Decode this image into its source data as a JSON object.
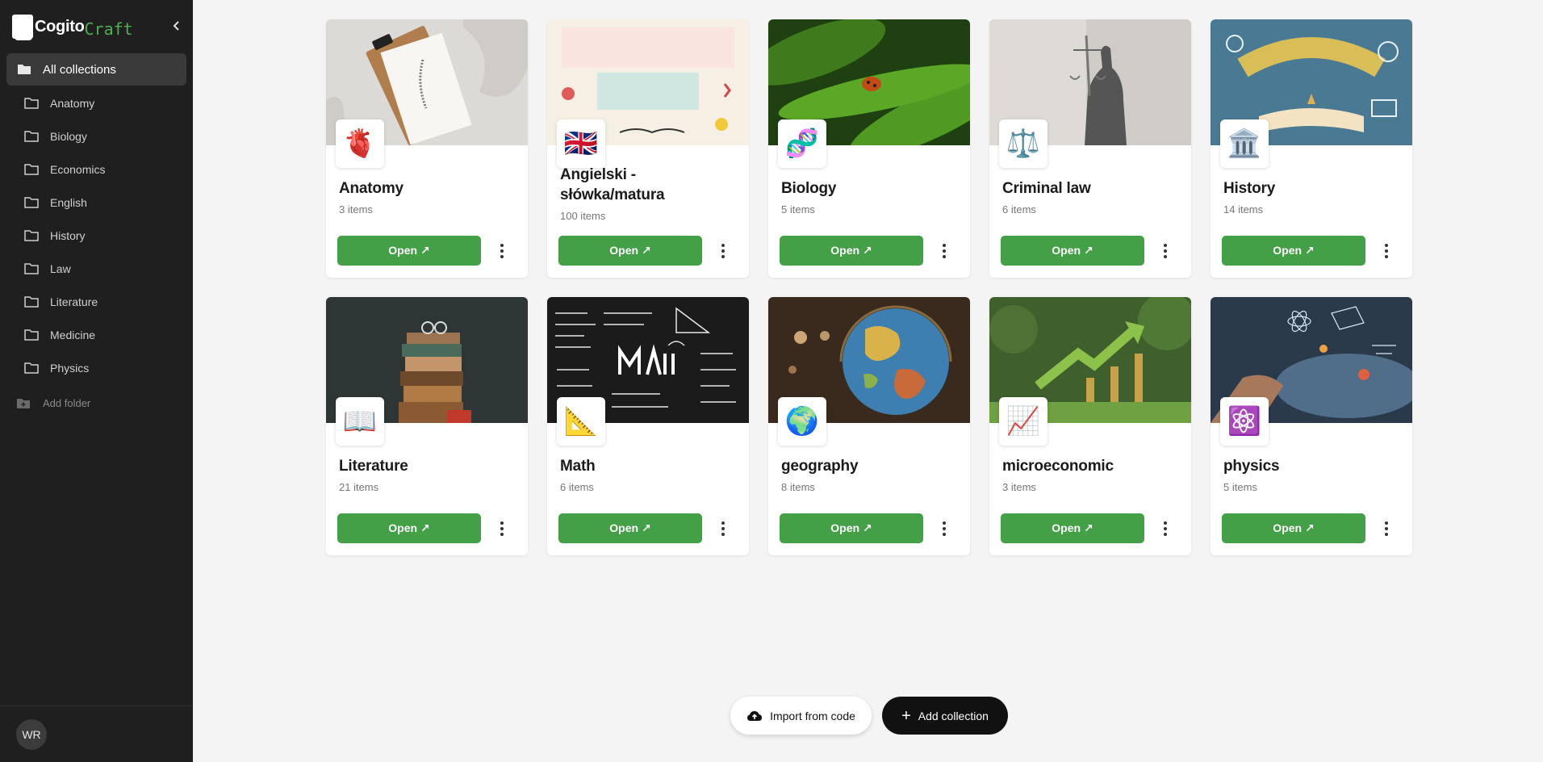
{
  "app": {
    "logo_part1": "Cogito",
    "logo_part2": "Craft"
  },
  "colors": {
    "accent": "#43a047",
    "sidebar_bg": "#1f1f1f",
    "page_bg": "#f4f4f4"
  },
  "sidebar": {
    "active_item": "All collections",
    "items": [
      "Anatomy",
      "Biology",
      "Economics",
      "English",
      "History",
      "Law",
      "Literature",
      "Medicine",
      "Physics"
    ],
    "add_folder": "Add folder",
    "user_initials": "WR"
  },
  "collections": [
    {
      "title": "Anatomy",
      "count": "3 items",
      "icon": "anatomical-heart-icon",
      "glyph": "🫀",
      "open": "Open ↗"
    },
    {
      "title": "Angielski - słówka/matura",
      "count": "100 items",
      "icon": "uk-flag-icon",
      "glyph": "🇬🇧",
      "open": "Open ↗"
    },
    {
      "title": "Biology",
      "count": "5 items",
      "icon": "dna-icon",
      "glyph": "🧬",
      "open": "Open ↗"
    },
    {
      "title": "Criminal law",
      "count": "6 items",
      "icon": "scales-icon",
      "glyph": "⚖️",
      "open": "Open ↗"
    },
    {
      "title": "History",
      "count": "14 items",
      "icon": "classical-building-icon",
      "glyph": "🏛️",
      "open": "Open ↗"
    },
    {
      "title": "Literature",
      "count": "21 items",
      "icon": "open-book-icon",
      "glyph": "📖",
      "open": "Open ↗"
    },
    {
      "title": "Math",
      "count": "6 items",
      "icon": "triangular-ruler-icon",
      "glyph": "📐",
      "open": "Open ↗"
    },
    {
      "title": "geography",
      "count": "8 items",
      "icon": "globe-icon",
      "glyph": "🌍",
      "open": "Open ↗"
    },
    {
      "title": "microeconomic",
      "count": "3 items",
      "icon": "chart-increasing-icon",
      "glyph": "📈",
      "open": "Open ↗"
    },
    {
      "title": "physics",
      "count": "5 items",
      "icon": "atom-icon",
      "glyph": "⚛️",
      "open": "Open ↗"
    }
  ],
  "actions": {
    "import": "Import from code",
    "add": "Add collection",
    "add_symbol": "+"
  }
}
